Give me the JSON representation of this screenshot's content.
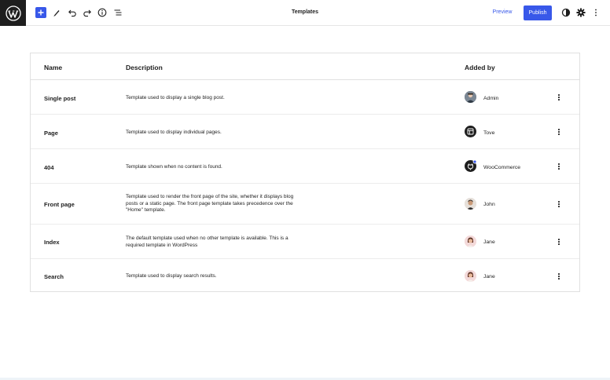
{
  "header": {
    "title": "Templates",
    "preview_label": "Preview",
    "publish_label": "Publish"
  },
  "table": {
    "columns": {
      "name": "Name",
      "description": "Description",
      "added_by": "Added by"
    },
    "rows": [
      {
        "name": "Single post",
        "description": "Template used to display a single blog post.",
        "author": "Admin",
        "avatar": "admin-avatar"
      },
      {
        "name": "Page",
        "description": "Template used to display individual pages.",
        "author": "Tove",
        "avatar": "theme-layout-icon"
      },
      {
        "name": "404",
        "description": "Template shown when no content is found.",
        "author": "WooCommerce",
        "avatar": "plugin-icon"
      },
      {
        "name": "Front page",
        "description": "Template used to render the front page of the site, whether it displays blog posts or a static page. The front page template takes precedence over the \"Home\" template.",
        "author": "John",
        "avatar": "john-avatar"
      },
      {
        "name": "Index",
        "description": "The default template used when no other template is available. This is a required template in WordPress",
        "author": "Jane",
        "avatar": "jane-avatar"
      },
      {
        "name": "Search",
        "description": "Template used to display search results.",
        "author": "Jane",
        "avatar": "jane-avatar"
      }
    ]
  },
  "colors": {
    "accent": "#3858e9",
    "dark": "#1e1e1e",
    "border": "#e0e0e0"
  }
}
